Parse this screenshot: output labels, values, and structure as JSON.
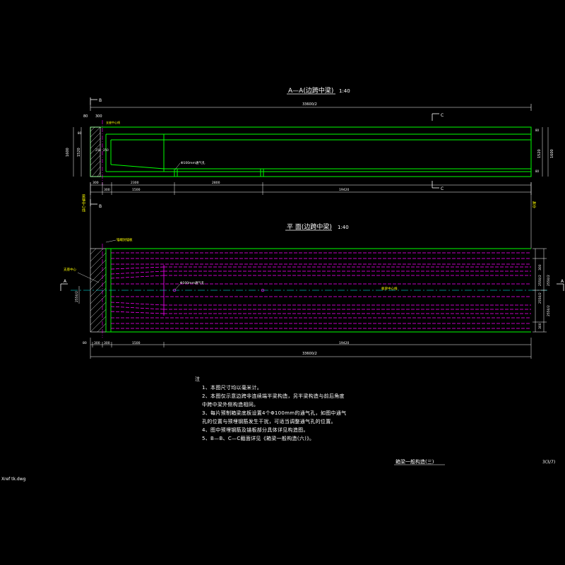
{
  "file_label": "Xref tk.dwg",
  "section_view": {
    "title": "A—A(边跨中梁)",
    "scale": "1:40",
    "total_dim": "33600/2",
    "dims_bottom": [
      "300",
      "300",
      "2300",
      "1500",
      "2800",
      "19420"
    ],
    "dims_left": [
      "80",
      "1600",
      "1520",
      "80"
    ],
    "dims_right": [
      "80",
      "1600",
      "1520",
      "80"
    ],
    "dims_inner": [
      "300",
      "250",
      "250"
    ],
    "labels": {
      "support_center": "支座中心线",
      "vent_hole": "Φ100mm通气孔",
      "cut_b_top": "B",
      "cut_b_bottom": "B",
      "cut_c_top": "C",
      "cut_c_bottom": "C"
    }
  },
  "left_vertical_label": "梁端中心线",
  "right_vertical_label": "跨中",
  "plan_view": {
    "title": "平 面(边跨中梁)",
    "scale": "1:40",
    "total_dim": "33600/2",
    "dims_bottom": [
      "80",
      "300",
      "300",
      "1500",
      "19420"
    ],
    "dims_right": [
      "300",
      "2550/2",
      "2550/2",
      "300"
    ],
    "labels": {
      "end_plate": "锚端封锚板",
      "support_center": "支座中心",
      "vent_hole": "Φ100mm通气孔",
      "beam_center": "板梁中心线",
      "cut_a_left": "A",
      "cut_a_right": "A",
      "dim_left": "2550/2"
    }
  },
  "notes": {
    "heading": "注",
    "items": [
      "1、本图尺寸均以毫米计。",
      "2、本图仅示意边跨非连续端半梁构造，另半梁构造与前后角度",
      "   中跨中梁外侧构造相同。",
      "3、每片预制箱梁底板设置4个Φ100mm的通气孔，如图中通气",
      "   孔的位置与预埋钢筋发生干扰，可适当调整通气孔的位置。",
      "4、图中预埋钢筋及锚板部分具体详见构造图。",
      "5、B—B、C—C截面详见《箱梁一般构造(六)》。"
    ]
  },
  "sheet_title": "箱梁一般构造(三)",
  "sheet_number": "3(3/7)",
  "colors": {
    "background": "#000000",
    "outline": "#00ff00",
    "tendon": "#ff00ff",
    "centerline": "#00ffff",
    "dimension": "#ffffff",
    "label": "#ffff00"
  }
}
